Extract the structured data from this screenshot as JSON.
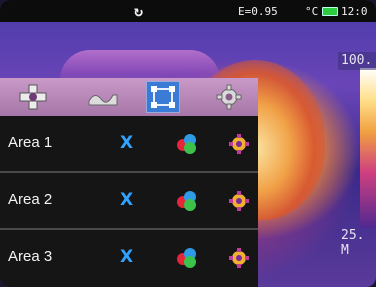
{
  "statusbar": {
    "refresh_icon": "refresh-icon",
    "emissivity": "E=0.95",
    "unit": "°C",
    "time": "12:0"
  },
  "scale": {
    "max": "100.",
    "min": "25.",
    "mode": "M"
  },
  "toolbar": {
    "tools": [
      {
        "icon": "crosshair-icon",
        "active": false
      },
      {
        "icon": "line-wave-icon",
        "active": false
      },
      {
        "icon": "area-box-icon",
        "active": true
      },
      {
        "icon": "settings-gear-icon",
        "active": false
      }
    ]
  },
  "areas": [
    {
      "label": "Area 1",
      "delete": "X"
    },
    {
      "label": "Area 2",
      "delete": "X"
    },
    {
      "label": "Area 3",
      "delete": "X"
    }
  ],
  "colors": {
    "accent": "#3a7bd5",
    "delete_x": "#2fa3ff",
    "toolbar": "#b884b8"
  }
}
